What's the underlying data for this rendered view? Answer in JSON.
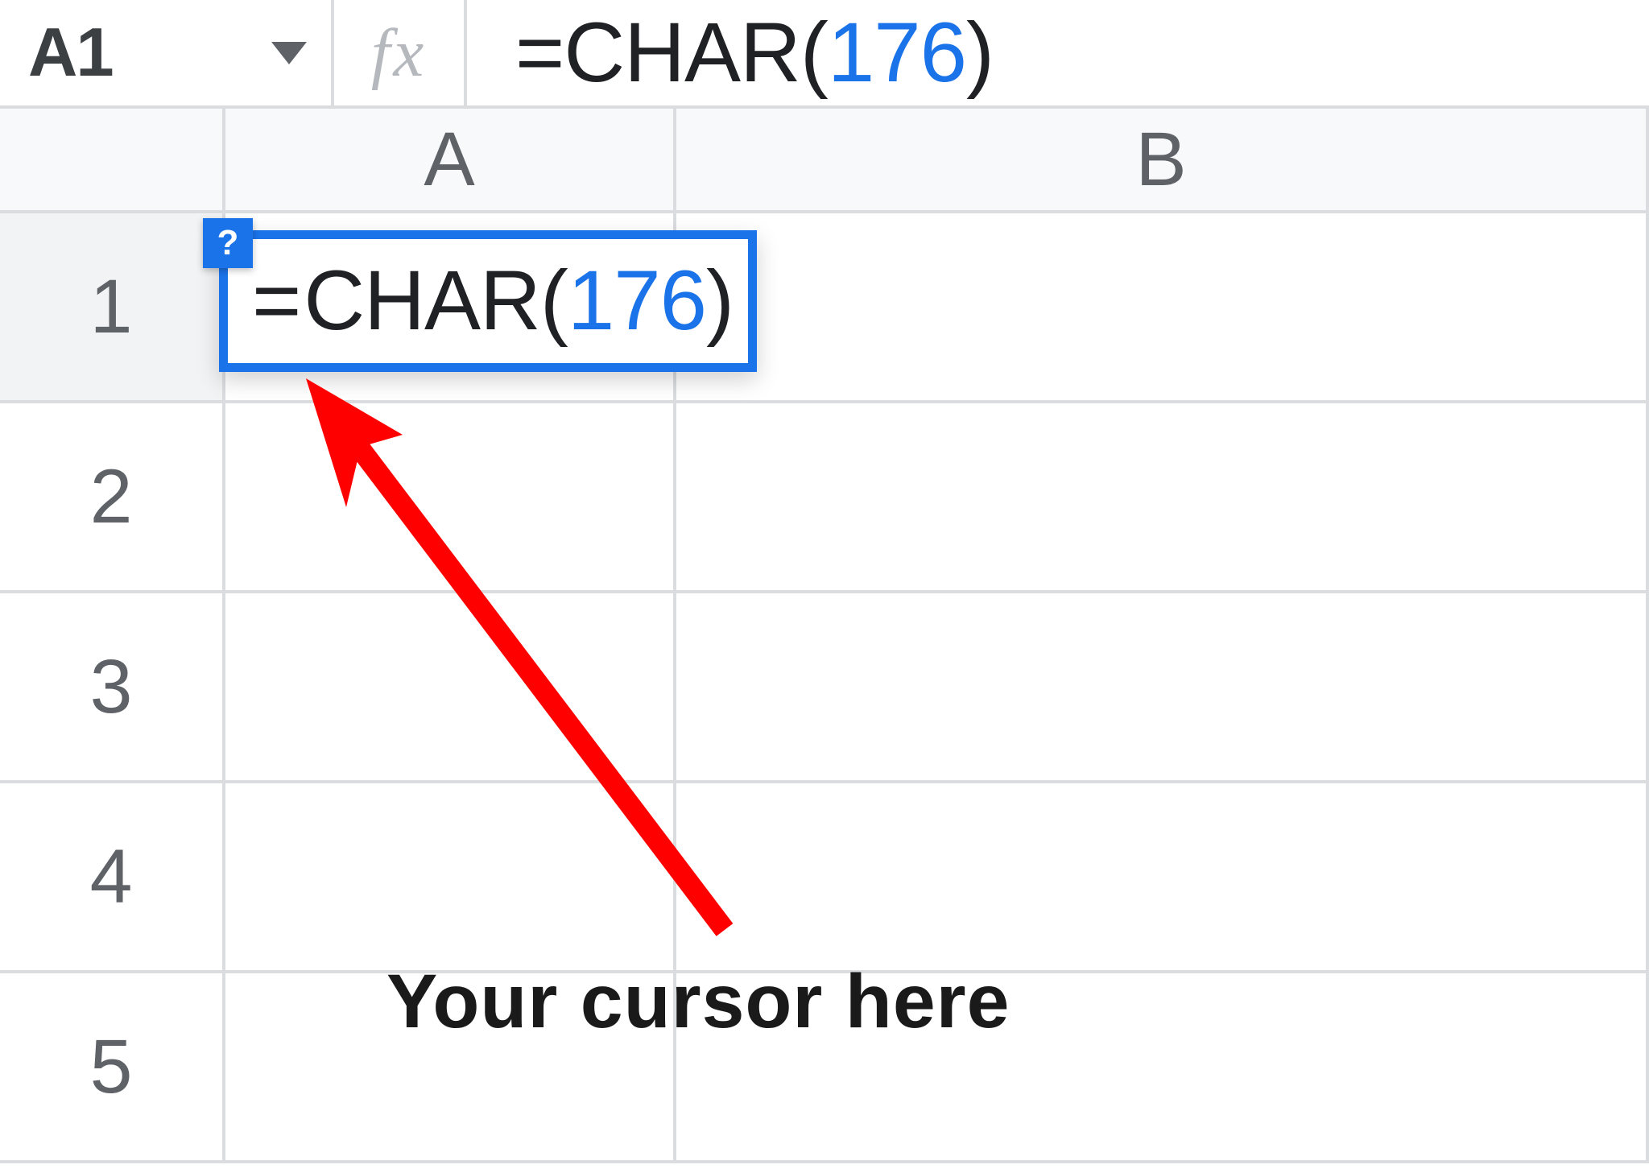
{
  "nameBox": {
    "value": "A1"
  },
  "fxLabel": "fx",
  "formulaBar": {
    "eq": "=",
    "fn": "CHAR",
    "open": "(",
    "arg": "176",
    "close": ")"
  },
  "columns": [
    "A",
    "B"
  ],
  "rows": [
    "1",
    "2",
    "3",
    "4",
    "5"
  ],
  "activeCell": {
    "eq": "=",
    "fn": "CHAR",
    "open": "(",
    "arg": "176",
    "close": ")"
  },
  "helpBadge": "?",
  "annotation": "Your cursor here",
  "colors": {
    "selection": "#1a73e8",
    "annotationArrow": "#ff0000"
  }
}
